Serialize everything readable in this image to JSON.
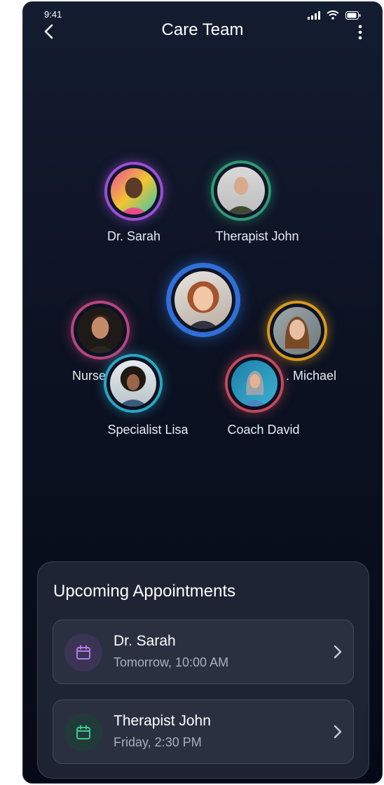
{
  "status": {
    "time": "9:41"
  },
  "header": {
    "title": "Care Team"
  },
  "team": [
    {
      "name": "Dr. Sarah",
      "ring": "#9b4fd6"
    },
    {
      "name": "Therapist John",
      "ring": "#2e9a74"
    },
    {
      "name": "Nurse",
      "ring": "#b8457e"
    },
    {
      "name": ". Michael",
      "ring": "#d89a1c"
    },
    {
      "name": "Specialist Lisa",
      "ring": "#2aa6c4"
    },
    {
      "name": "Coach David",
      "ring": "#c4485a"
    },
    {
      "name": "",
      "ring": "#2f6fd6"
    }
  ],
  "appointments": {
    "title": "Upcoming Appointments",
    "items": [
      {
        "name": "Dr. Sarah",
        "time": "Tomorrow, 10:00 AM",
        "icon": "calendar-icon",
        "color": "#b57bf0"
      },
      {
        "name": "Therapist John",
        "time": "Friday, 2:30 PM",
        "icon": "calendar-icon",
        "color": "#3ec98f"
      }
    ]
  }
}
